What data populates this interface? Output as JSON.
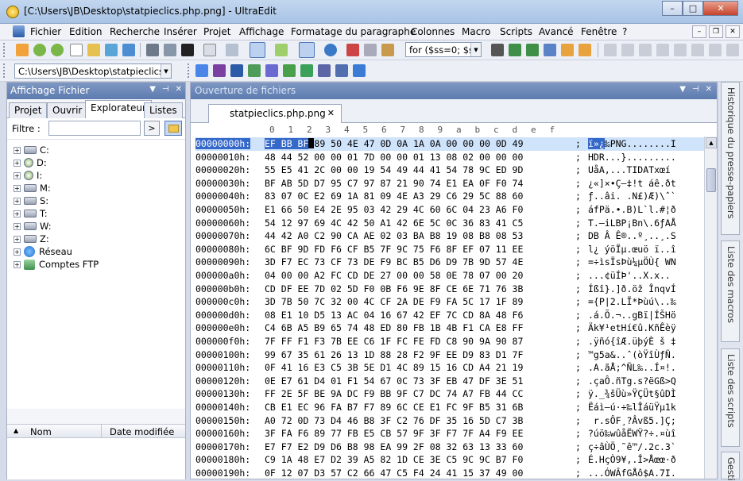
{
  "window": {
    "title": "[C:\\Users\\JB\\Desktop\\statpieclics.php.png] - UltraEdit",
    "min_label": "–",
    "max_label": "□",
    "close_label": "✕"
  },
  "menu": [
    "Fichier",
    "Edition",
    "Recherche",
    "Insérer",
    "Projet",
    "Affichage",
    "Formatage du paragraphe",
    "Colonnes",
    "Macro",
    "Scripts",
    "Avancé",
    "Fenêtre",
    "?"
  ],
  "toolbar": {
    "search_combo": "for ($ss=0; $ss",
    "path_combo": "C:\\Users\\JB\\Desktop\\statpieclics.",
    "accent": "#5d7bb0"
  },
  "file_panel": {
    "title": "Affichage Fichier",
    "tabs": [
      "Projet",
      "Ouvrir",
      "Explorateur",
      "Listes"
    ],
    "active_tab": "Explorateur",
    "filter_label": "Filtre :",
    "filter_value": "",
    "go_label": ">",
    "tree": [
      {
        "label": "C:",
        "type": "drive"
      },
      {
        "label": "D:",
        "type": "cd"
      },
      {
        "label": "I:",
        "type": "cd"
      },
      {
        "label": "M:",
        "type": "drive"
      },
      {
        "label": "S:",
        "type": "drive"
      },
      {
        "label": "T:",
        "type": "drive"
      },
      {
        "label": "W:",
        "type": "drive"
      },
      {
        "label": "Z:",
        "type": "drive"
      },
      {
        "label": "Réseau",
        "type": "network"
      },
      {
        "label": "Comptes FTP",
        "type": "ftp"
      }
    ],
    "columns": {
      "name": "Nom",
      "date": "Date modifiée"
    }
  },
  "editor": {
    "title": "Ouverture de fichiers",
    "tab_label": "statpieclics.php.png",
    "ruler": [
      "0",
      "1",
      "2",
      "3",
      "4",
      "5",
      "6",
      "7",
      "8",
      "9",
      "a",
      "b",
      "c",
      "d",
      "e",
      "f"
    ],
    "rows": [
      {
        "off": "00000000h:",
        "hex": "EF BB BF 89 50 4E 47 0D 0A 1A 0A 00 00 00 0D 49",
        "asc": "ï»¿‰PNG........I"
      },
      {
        "off": "00000010h:",
        "hex": "48 44 52 00 00 01 7D 00 00 01 13 08 02 00 00 00",
        "asc": "HDR...}........."
      },
      {
        "off": "00000020h:",
        "hex": "55 E5 41 2C 00 00 19 54 49 44 41 54 78 9C ED 9D",
        "asc": "UåA,...TIDATxœí"
      },
      {
        "off": "00000030h:",
        "hex": "BF AB 5D D7 95 C7 97 87 21 90 74 E1 EA 0F F0 74",
        "asc": "¿«]×•Ç—‡!t áê.ðt"
      },
      {
        "off": "00000040h:",
        "hex": "83 07 0C E2 69 1A 81 09 4E A3 29 C6 29 5C 88 60",
        "asc": "ƒ..âi. .N£)Æ)\\ˆ`"
      },
      {
        "off": "00000050h:",
        "hex": "E1 66 50 E4 2E 95 03 42 29 4C 60 6C 04 23 A6 F0",
        "asc": "áfPä.•.B)L`l.#¦ð"
      },
      {
        "off": "00000060h:",
        "hex": "54 12 97 69 4C 42 50 A1 42 6E 5C 0C 36 83 41 C5",
        "asc": "T.—iLBP¡Bn\\.6ƒAÅ"
      },
      {
        "off": "00000070h:",
        "hex": "44 42 A0 C2 90 CA AE 02 03 BA B8 19 08 B8 08 53",
        "asc": "DB Â Ê®..º¸..¸.S"
      },
      {
        "off": "00000080h:",
        "hex": "6C BF 9D FD F6 CF B5 7F 9C 75 F6 8F EF 07 11 EE",
        "asc": "l¿ ýöÏµ.œuö ï..î"
      },
      {
        "off": "00000090h:",
        "hex": "3D F7 EC 73 CF 73 DE F9 BC B5 D6 D9 7B 9D 57 4E",
        "asc": "=÷ìsÏsÞù¼µÖÙ{ WN"
      },
      {
        "off": "000000a0h:",
        "hex": "04 00 00 A2 FC CD DE 27 00 00 58 0E 78 07 00 20",
        "asc": "...¢üÍÞ'..X.x.. "
      },
      {
        "off": "000000b0h:",
        "hex": "CD DF EE 7D 02 5D F0 0B F6 9E 8F CE 6E 71 76 3B",
        "asc": "Íßî}.]ð.öž ÎnqvÍ"
      },
      {
        "off": "000000c0h:",
        "hex": "3D 7B 50 7C 32 00 4C CF 2A DE F9 FA 5C 17 1F 89",
        "asc": "={P|2.LÏ*Þùú\\..‰"
      },
      {
        "off": "000000d0h:",
        "hex": "08 E1 10 D5 13 AC 04 16 67 42 EF 7C CD 8A 48 F6",
        "asc": ".á.Õ.¬..gBï|ÍŠHö"
      },
      {
        "off": "000000e0h:",
        "hex": "C4 6B A5 B9 65 74 48 ED 80 FB 1B 4B F1 CA E8 FF",
        "asc": "Äk¥¹etHí€û.KñÊèÿ"
      },
      {
        "off": "000000f0h:",
        "hex": "7F FF F1 F3 7B EE C6 1F FC FE FD C8 90 9A 90 87",
        "asc": ".ÿñó{îÆ.üþýÈ š ‡"
      },
      {
        "off": "00000100h:",
        "hex": "99 67 35 61 26 13 1D 88 28 F2 9F EE D9 83 D1 7F",
        "asc": "™g5a&..ˆ(òŸîÙƒÑ."
      },
      {
        "off": "00000110h:",
        "hex": "0F 41 16 E3 C5 3B 5E D1 4C 89 15 16 CD A4 21 19",
        "asc": ".A.ãÅ;^ÑL‰..Í¤!."
      },
      {
        "off": "00000120h:",
        "hex": "0E E7 61 D4 01 F1 54 67 0C 73 3F EB 47 DF 3E 51",
        "asc": ".çaÔ.ñTg.s?ëGß>Q"
      },
      {
        "off": "00000130h:",
        "hex": "FF 2E 5F BE 9A DC F9 BB 9F C7 DC 74 A7 FB 44 CC",
        "asc": "ÿ._¾šÜù»ŸÇÜt§ûDÌ"
      },
      {
        "off": "00000140h:",
        "hex": "CB E1 EC 96 FA B7 F7 89 6C CE E1 FC 9F B5 31 6B",
        "asc": "Ëáì–ú·÷‰lÎáüŸµ1k"
      },
      {
        "off": "00000150h:",
        "hex": "A0 72 0D 73 D4 46 B8 3F C2 76 DF 35 16 5D C7 3B",
        "asc": " r.sÔF¸?Âvß5.]Ç;"
      },
      {
        "off": "00000160h:",
        "hex": "3F FA F6 89 77 FB E5 CB 57 9F 3F F7 7F A4 F9 EE",
        "asc": "?úö‰wûåËWŸ?÷.¤ùî"
      },
      {
        "off": "00000170h:",
        "hex": "E7 F7 E2 D9 D6 B8 98 EA 99 2F 08 32 63 13 33 60",
        "asc": "ç÷âÙÖ¸˜ê™/.2c.3`"
      },
      {
        "off": "00000180h:",
        "hex": "C9 1A 48 E7 D2 39 A5 82 1D CE 3E C5 9C 9C B7 F0",
        "asc": "É.HçÒ9¥‚.Î>Åœœ·ð"
      },
      {
        "off": "00000190h:",
        "hex": "0F 12 07 D3 57 C2 66 47 C5 F4 24 41 15 37 49 00",
        "asc": "...ÓWÂfGÅô$A.7I."
      }
    ]
  },
  "side_tabs": [
    "Historique du presse-papiers",
    "Liste des macros",
    "Liste des scripts",
    "Gesti"
  ]
}
